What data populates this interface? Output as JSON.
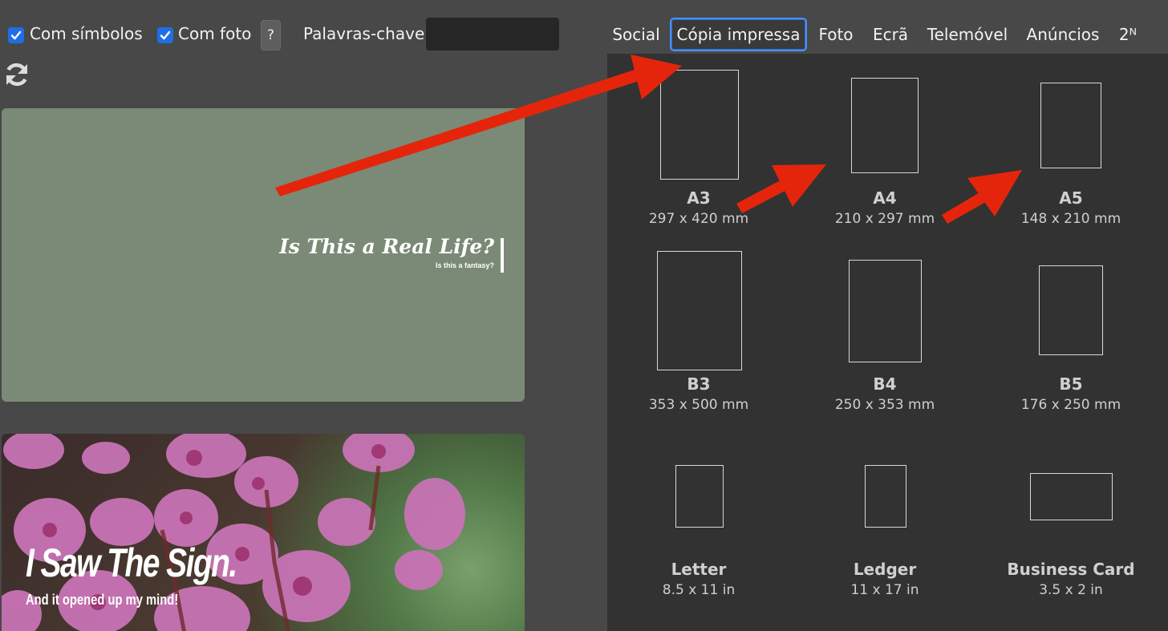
{
  "toolbar": {
    "with_symbols_label": "Com símbolos",
    "with_photo_label": "Com foto",
    "help_label": "?",
    "keywords_label": "Palavras-chave:",
    "keywords_value": ""
  },
  "cards": [
    {
      "title": "Is This a Real Life?",
      "subtitle": "Is this a fantasy?",
      "bg": "#7a8a76"
    },
    {
      "title": "I Saw The Sign.",
      "subtitle": "And it opened up my mind!"
    }
  ],
  "tabs": [
    {
      "label": "Social",
      "active": false
    },
    {
      "label": "Cópia impressa",
      "active": true
    },
    {
      "label": "Foto",
      "active": false
    },
    {
      "label": "Ecrã",
      "active": false
    },
    {
      "label": "Telemóvel",
      "active": false
    },
    {
      "label": "Anúncios",
      "active": false
    },
    {
      "label": "2ᴺ",
      "active": false
    }
  ],
  "sizes": [
    {
      "name": "A3",
      "dims": "297 x 420 mm"
    },
    {
      "name": "A4",
      "dims": "210 x 297 mm"
    },
    {
      "name": "A5",
      "dims": "148 x 210 mm"
    },
    {
      "name": "B3",
      "dims": "353 x 500 mm"
    },
    {
      "name": "B4",
      "dims": "250 x 353 mm"
    },
    {
      "name": "B5",
      "dims": "176 x 250 mm"
    },
    {
      "name": "Letter",
      "dims": "8.5 x 11 in"
    },
    {
      "name": "Ledger",
      "dims": "11 x 17 in"
    },
    {
      "name": "Business Card",
      "dims": "3.5 x 2 in"
    }
  ],
  "colors": {
    "accent": "#1f6ee6",
    "annotation_arrow": "#e4250c",
    "panel_bg": "#323232",
    "page_bg": "#484848"
  },
  "icons": {
    "refresh": "refresh-icon",
    "checkbox": "check-icon"
  }
}
